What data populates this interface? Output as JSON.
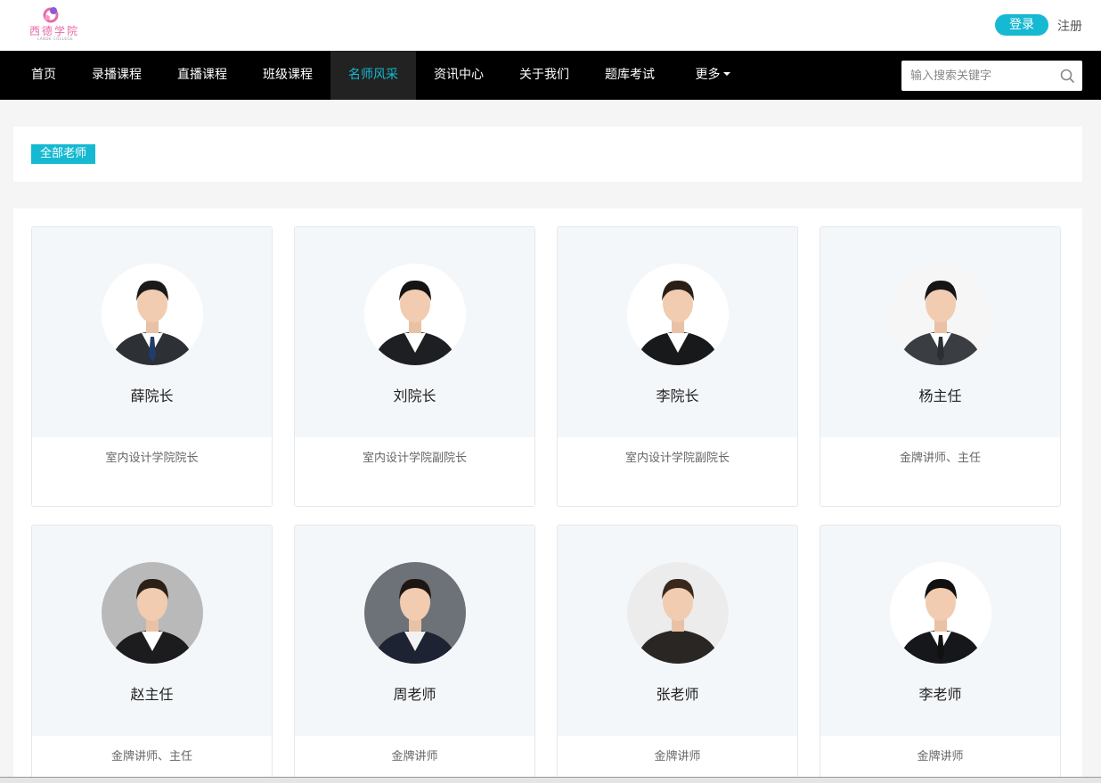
{
  "header": {
    "logo_text": "西德学院",
    "logo_sub": "LANDE COLLEGE",
    "login_label": "登录",
    "register_label": "注册"
  },
  "nav": {
    "items": [
      {
        "label": "首页"
      },
      {
        "label": "录播课程"
      },
      {
        "label": "直播课程"
      },
      {
        "label": "班级课程"
      },
      {
        "label": "名师风采",
        "active": true
      },
      {
        "label": "资讯中心"
      },
      {
        "label": "关于我们"
      },
      {
        "label": "题库考试"
      },
      {
        "label": "更多"
      }
    ],
    "search_placeholder": "输入搜索关键字"
  },
  "filter": {
    "all_teachers_label": "全部老师"
  },
  "teachers": [
    {
      "name": "薛院长",
      "title": "室内设计学院院长",
      "bg": "#ffffff",
      "suit": "#2d3035",
      "shirt": "#ffffff",
      "tie": "#1f3d6b",
      "hair": "#1a1a1a"
    },
    {
      "name": "刘院长",
      "title": "室内设计学院副院长",
      "bg": "#ffffff",
      "suit": "#1e1f22",
      "shirt": "#ffffff",
      "tie": "",
      "hair": "#141414"
    },
    {
      "name": "李院长",
      "title": "室内设计学院副院长",
      "bg": "#ffffff",
      "suit": "#18191b",
      "shirt": "#ffffff",
      "tie": "",
      "hair": "#2a1e16"
    },
    {
      "name": "杨主任",
      "title": "金牌讲师、主任",
      "bg": "#f6f6f6",
      "suit": "#3a3d42",
      "shirt": "#ffffff",
      "tie": "#2b2e33",
      "hair": "#151515"
    },
    {
      "name": "赵主任",
      "title": "金牌讲师、主任",
      "bg": "#b9b9b9",
      "suit": "#1c1c1e",
      "shirt": "#ffffff",
      "tie": "",
      "hair": "#2b2018"
    },
    {
      "name": "周老师",
      "title": "金牌讲师",
      "bg": "#6d7178",
      "suit": "#1d2333",
      "shirt": "#f2f2f2",
      "tie": "",
      "hair": "#1e1612"
    },
    {
      "name": "张老师",
      "title": "金牌讲师",
      "bg": "#ececec",
      "suit": "#2a2624",
      "shirt": "#2a2624",
      "tie": "",
      "hair": "#3a281c"
    },
    {
      "name": "李老师",
      "title": "金牌讲师",
      "bg": "#ffffff",
      "suit": "#16171a",
      "shirt": "#ffffff",
      "tie": "#111111",
      "hair": "#101010"
    }
  ],
  "colors": {
    "accent": "#15b9d1",
    "nav_bg": "#000000",
    "logo_pink": "#e86aa6",
    "card_top_bg": "#f4f7fa"
  }
}
